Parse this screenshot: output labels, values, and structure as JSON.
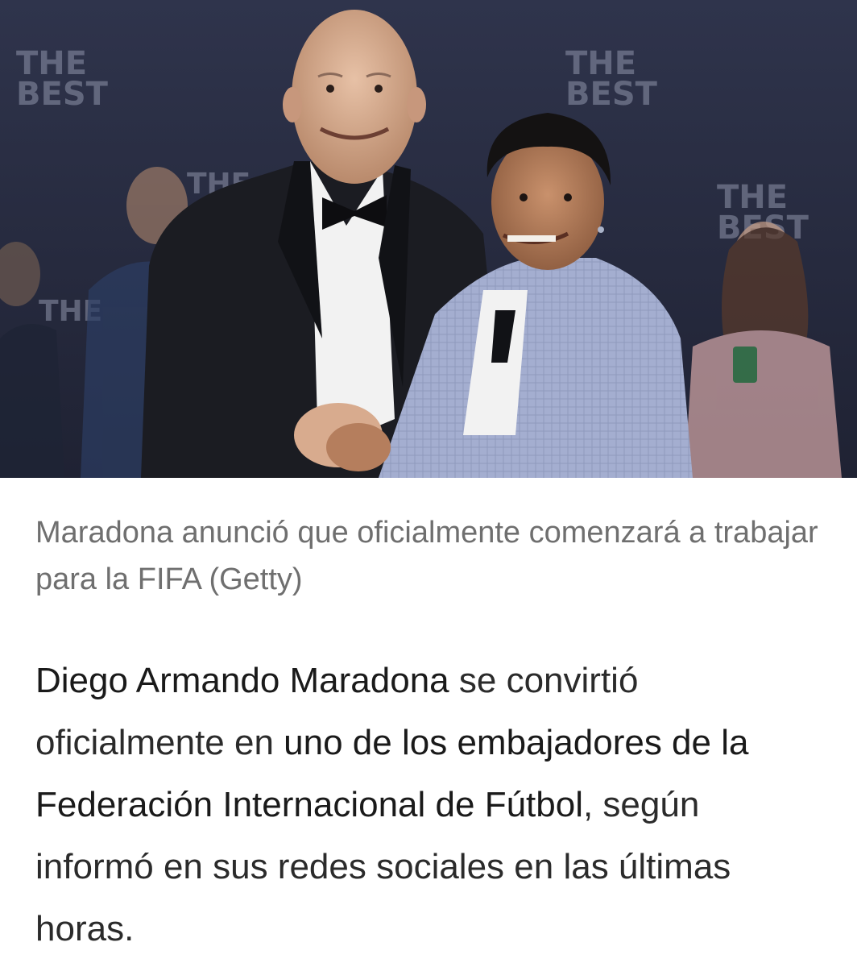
{
  "photo": {
    "description_icon": "photo-image",
    "backdrop_logo_text": [
      "THE",
      "BEST"
    ],
    "colors": {
      "backdrop": "#2a2f44",
      "suit_dark": "#1b1c22",
      "suit_light": "#9ea8c8",
      "shirt": "#f2f2f2",
      "dress": "#d7a9aa"
    }
  },
  "caption": {
    "text": "Maradona anunció que oficialmente comenzará a trabajar para la FIFA (Getty)"
  },
  "article": {
    "name_bold": "Diego Armando Maradona",
    "text_1": " se convirtió oficialmente en ",
    "role_bold": "uno de los embajadores de la Federación Internacional de Fútbol",
    "text_2": ", según informó en sus redes sociales en las últimas horas."
  }
}
